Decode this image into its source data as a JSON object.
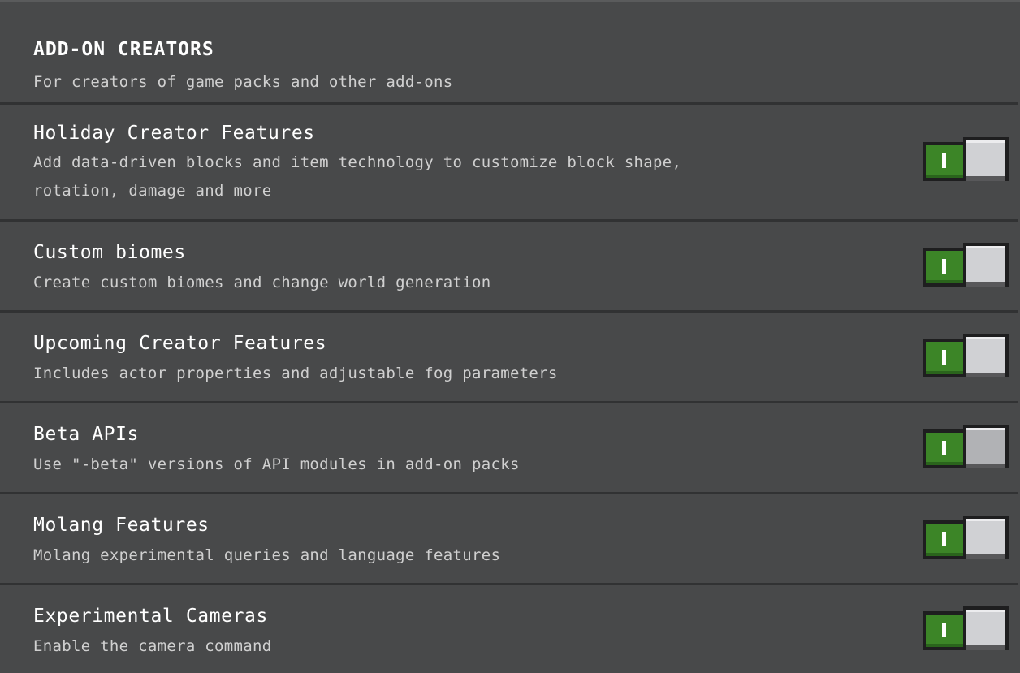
{
  "section": {
    "title": "ADD-ON CREATORS",
    "subtitle": "For creators of game packs and other add-ons"
  },
  "experiments": [
    {
      "title": "Holiday Creator Features",
      "description": "Add data-driven blocks and item technology to customize block shape, rotation, damage and more",
      "enabled": true
    },
    {
      "title": "Custom biomes",
      "description": "Create custom biomes and change world generation",
      "enabled": true
    },
    {
      "title": "Upcoming Creator Features",
      "description": "Includes actor properties and adjustable fog parameters",
      "enabled": true
    },
    {
      "title": "Beta APIs",
      "description": "Use \"-beta\" versions of API modules in add-on packs",
      "enabled": true
    },
    {
      "title": "Molang Features",
      "description": "Molang experimental queries and language features",
      "enabled": true
    },
    {
      "title": "Experimental Cameras",
      "description": "Enable the camera command",
      "enabled": true
    }
  ],
  "colors": {
    "background": "#48494a",
    "toggle_on": "#3c8527",
    "knob": "#d0d1d4"
  },
  "icons": {
    "toggle_on_mark": "toggle-on-indicator-icon"
  }
}
